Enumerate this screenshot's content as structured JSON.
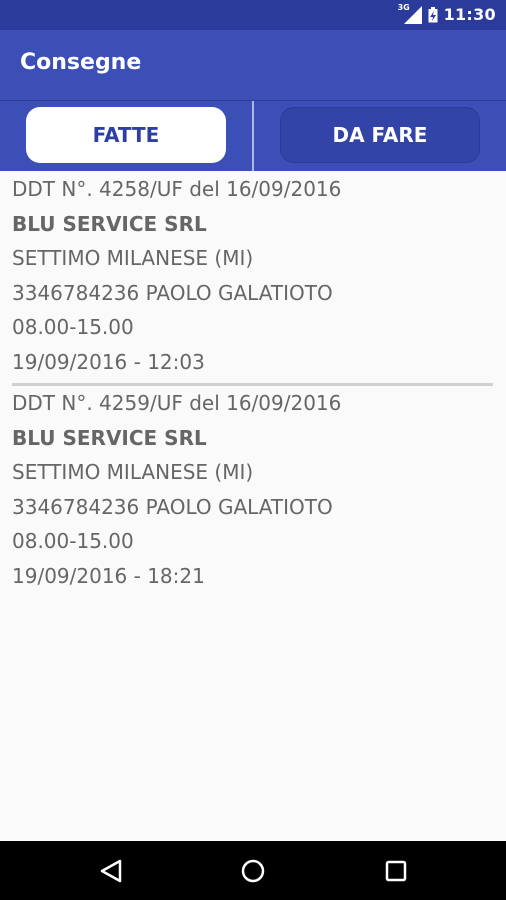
{
  "status_bar": {
    "network": "3G",
    "time": "11:30",
    "icons": [
      "signal-icon",
      "battery-charging-icon"
    ]
  },
  "app_bar": {
    "title": "Consegne"
  },
  "tabs": [
    {
      "label": "FATTE",
      "selected": true
    },
    {
      "label": "DA FARE",
      "selected": false
    }
  ],
  "deliveries": [
    {
      "ddt": "DDT N°. 4258/UF del 16/09/2016",
      "company": "BLU SERVICE SRL",
      "city": "SETTIMO MILANESE (MI)",
      "contact": "3346784236 PAOLO GALATIOTO",
      "hours": "08.00-15.00",
      "completed": "19/09/2016 - 12:03"
    },
    {
      "ddt": "DDT N°. 4259/UF del 16/09/2016",
      "company": "BLU SERVICE SRL",
      "city": "SETTIMO MILANESE (MI)",
      "contact": "3346784236 PAOLO GALATIOTO",
      "hours": "08.00-15.00",
      "completed": "19/09/2016 - 18:21"
    }
  ],
  "nav_bar": {
    "buttons": [
      "back-icon",
      "home-icon",
      "recents-icon"
    ]
  },
  "colors": {
    "primary": "#3b4fb6",
    "status_bar": "#2a3b9c",
    "text": "#666666"
  }
}
